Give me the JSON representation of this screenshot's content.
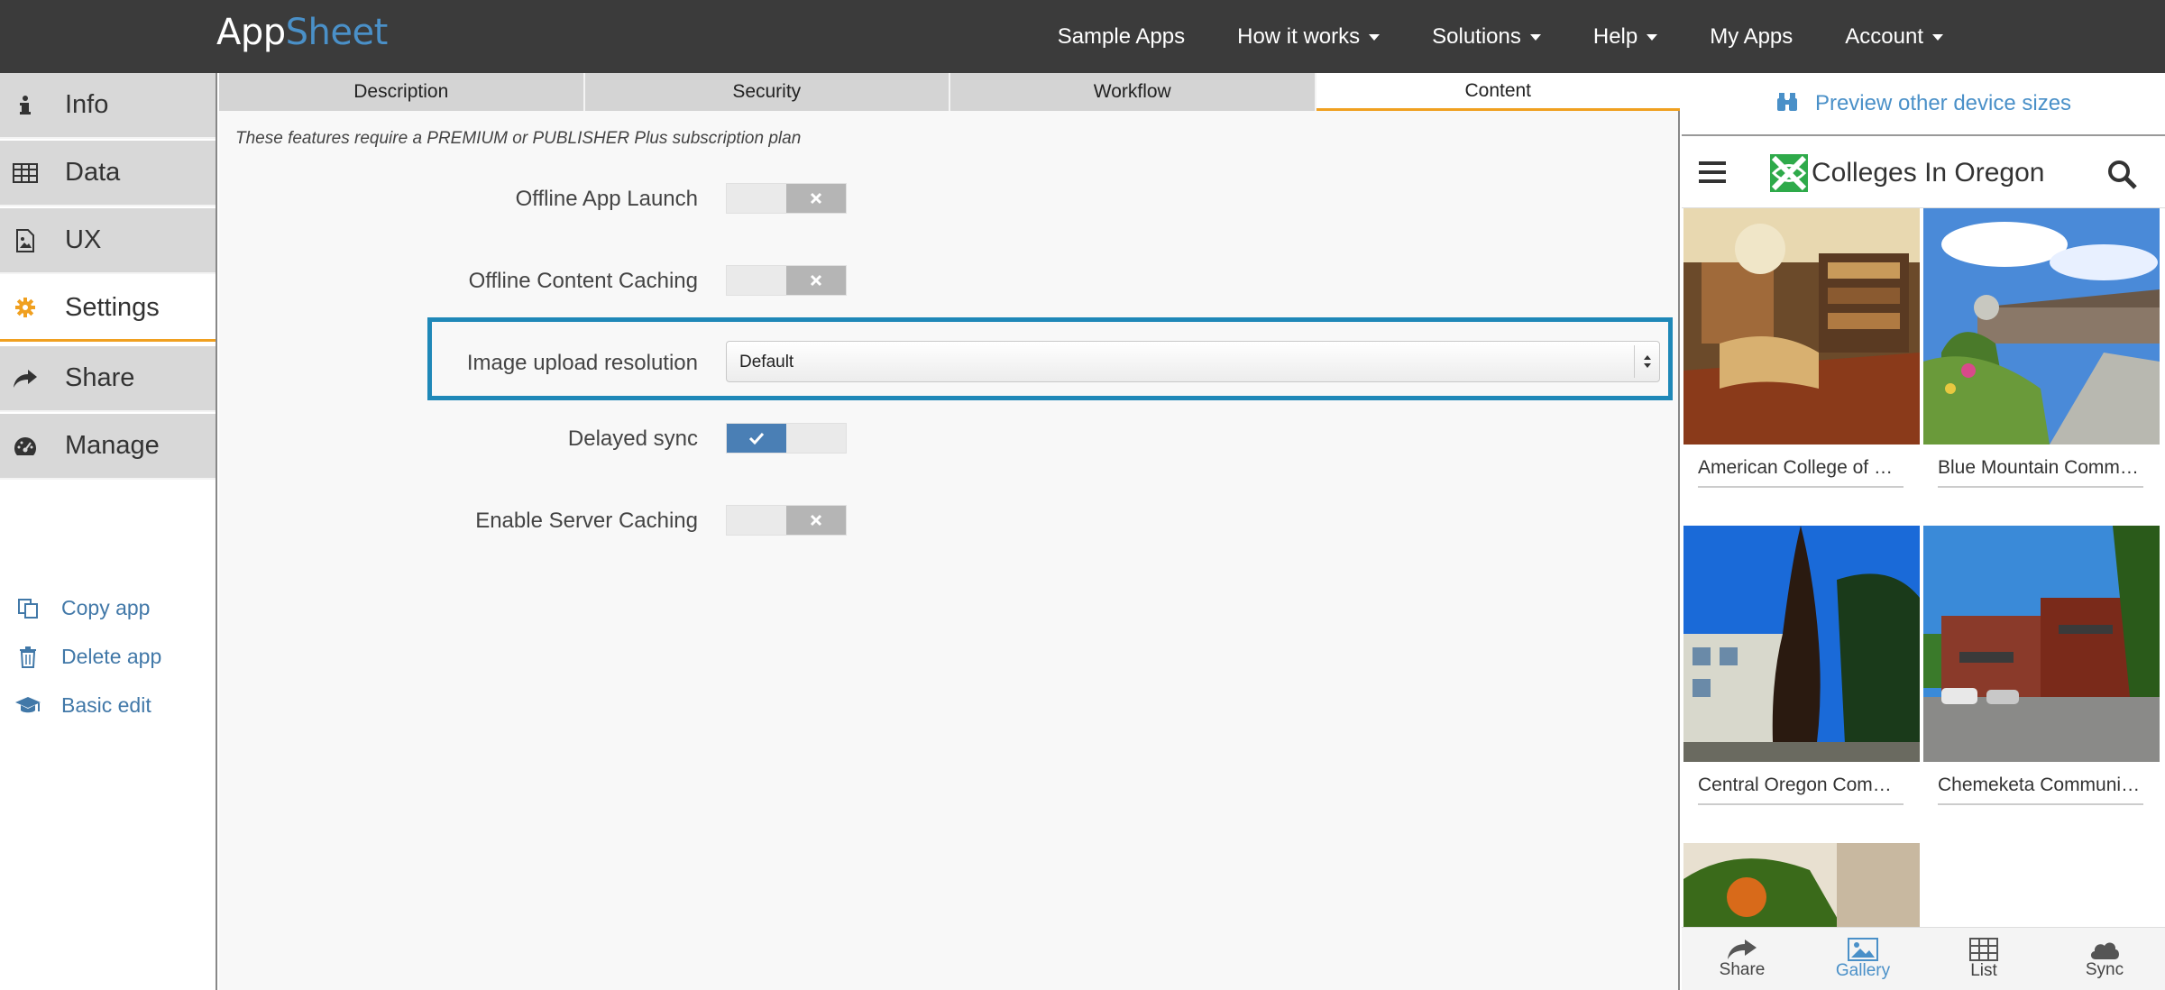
{
  "nav": {
    "logo_part1": "App",
    "logo_part2": "Sheet",
    "items": [
      {
        "label": "Sample Apps",
        "dropdown": false
      },
      {
        "label": "How it works",
        "dropdown": true
      },
      {
        "label": "Solutions",
        "dropdown": true
      },
      {
        "label": "Help",
        "dropdown": true
      },
      {
        "label": "My Apps",
        "dropdown": false
      },
      {
        "label": "Account",
        "dropdown": true
      }
    ]
  },
  "sidebar": {
    "items": [
      {
        "label": "Info",
        "icon": "info-icon"
      },
      {
        "label": "Data",
        "icon": "table-icon"
      },
      {
        "label": "UX",
        "icon": "image-file-icon"
      },
      {
        "label": "Settings",
        "icon": "gear-icon",
        "active": true
      },
      {
        "label": "Share",
        "icon": "share-icon"
      },
      {
        "label": "Manage",
        "icon": "dashboard-icon"
      }
    ],
    "links": [
      {
        "label": "Copy app",
        "icon": "copy-icon"
      },
      {
        "label": "Delete app",
        "icon": "trash-icon"
      },
      {
        "label": "Basic edit",
        "icon": "graduation-cap-icon"
      }
    ]
  },
  "tabs": [
    "Description",
    "Security",
    "Workflow",
    "Content"
  ],
  "active_tab": "Content",
  "notice": "These features require a PREMIUM or PUBLISHER Plus subscription plan",
  "settings": {
    "offline_launch": {
      "label": "Offline App Launch",
      "enabled": false
    },
    "offline_caching": {
      "label": "Offline Content Caching",
      "enabled": false
    },
    "image_resolution": {
      "label": "Image upload resolution",
      "value": "Default"
    },
    "delayed_sync": {
      "label": "Delayed sync",
      "enabled": true
    },
    "server_caching": {
      "label": "Enable Server Caching",
      "enabled": false
    }
  },
  "preview": {
    "link": "Preview other device sizes",
    "app_title": "Colleges In Oregon",
    "tiles": [
      "American College of Healthcare Sciences",
      "Blue Mountain Community College",
      "Central Oregon Community College",
      "Chemeketa Community College"
    ],
    "bottom": [
      "Share",
      "Gallery",
      "List",
      "Sync"
    ],
    "active_bottom": "Gallery"
  },
  "colors": {
    "accent": "#f0a020",
    "link": "#4a90c8",
    "highlight": "#1f88b8",
    "toggle_on": "#4a7fb5"
  }
}
